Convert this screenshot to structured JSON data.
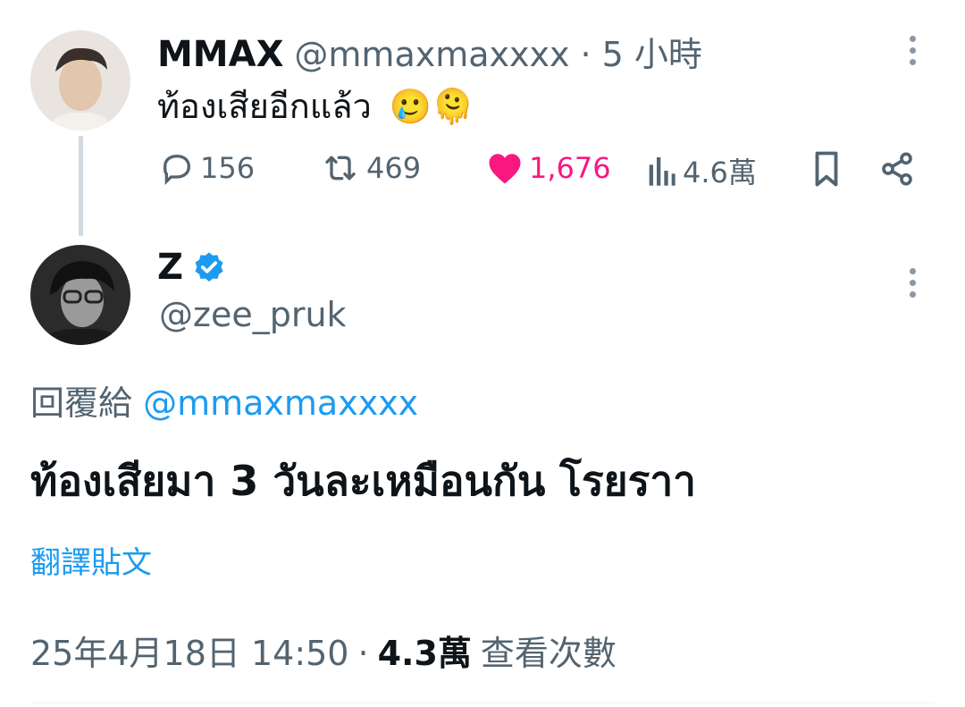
{
  "parent_tweet": {
    "author_name": "MMAX",
    "handle": "@mmaxmaxxxx",
    "separator": "·",
    "time": "5 小時",
    "text": "ท้องเสียอีกแล้ว",
    "emojis": "🥲🫠",
    "stats": {
      "replies": "156",
      "retweets": "469",
      "likes": "1,676",
      "views": "4.6萬"
    }
  },
  "reply_tweet": {
    "author_name": "Z",
    "handle": "@zee_pruk",
    "replying_prefix": "回覆給",
    "replying_to": "@mmaxmaxxxx",
    "text": "ท้องเสียมา 3 วันละเหมือนกัน โรยราา",
    "translate_label": "翻譯貼文",
    "timestamp": "25年4月18日 14:50",
    "separator": "·",
    "views_count": "4.3萬",
    "views_label": "查看次數"
  },
  "colors": {
    "like_active": "#f91880",
    "link": "#1d9bf0",
    "muted": "#536471",
    "verified": "#1d9bf0"
  },
  "icons": [
    "reply-icon",
    "retweet-icon",
    "like-icon",
    "views-icon",
    "bookmark-icon",
    "share-icon",
    "more-icon",
    "verified-badge-icon"
  ]
}
